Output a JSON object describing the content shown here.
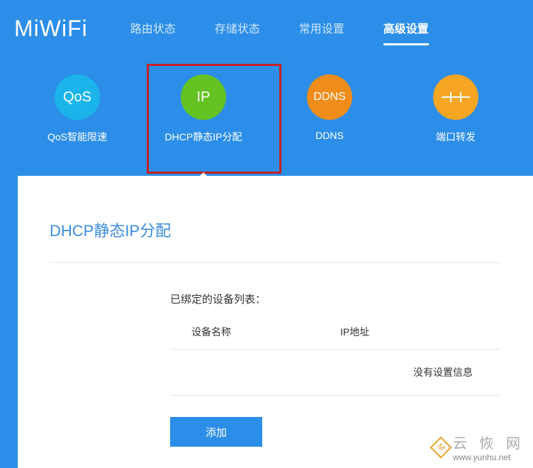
{
  "header": {
    "logo": "MiWiFi",
    "nav": [
      {
        "label": "路由状态",
        "active": false
      },
      {
        "label": "存储状态",
        "active": false
      },
      {
        "label": "常用设置",
        "active": false
      },
      {
        "label": "高级设置",
        "active": true
      }
    ]
  },
  "features": [
    {
      "icon_text": "QoS",
      "label": "QoS智能限速",
      "color": "c-blue",
      "highlighted": false
    },
    {
      "icon_text": "IP",
      "label": "DHCP静态IP分配",
      "color": "c-green",
      "highlighted": true
    },
    {
      "icon_text": "DDNS",
      "label": "DDNS",
      "color": "c-orange",
      "highlighted": false
    },
    {
      "icon_text": "",
      "label": "端口转发",
      "color": "c-yellow",
      "highlighted": false,
      "icon_type": "port"
    }
  ],
  "panel": {
    "title": "DHCP静态IP分配",
    "list_label": "已绑定的设备列表：",
    "columns": {
      "name": "设备名称",
      "ip": "IP地址"
    },
    "empty_text": "没有设置信息",
    "add_button": "添加"
  },
  "watermark": {
    "badge": "M",
    "text": "云 恢 网",
    "url": "www.yunhu.net"
  }
}
